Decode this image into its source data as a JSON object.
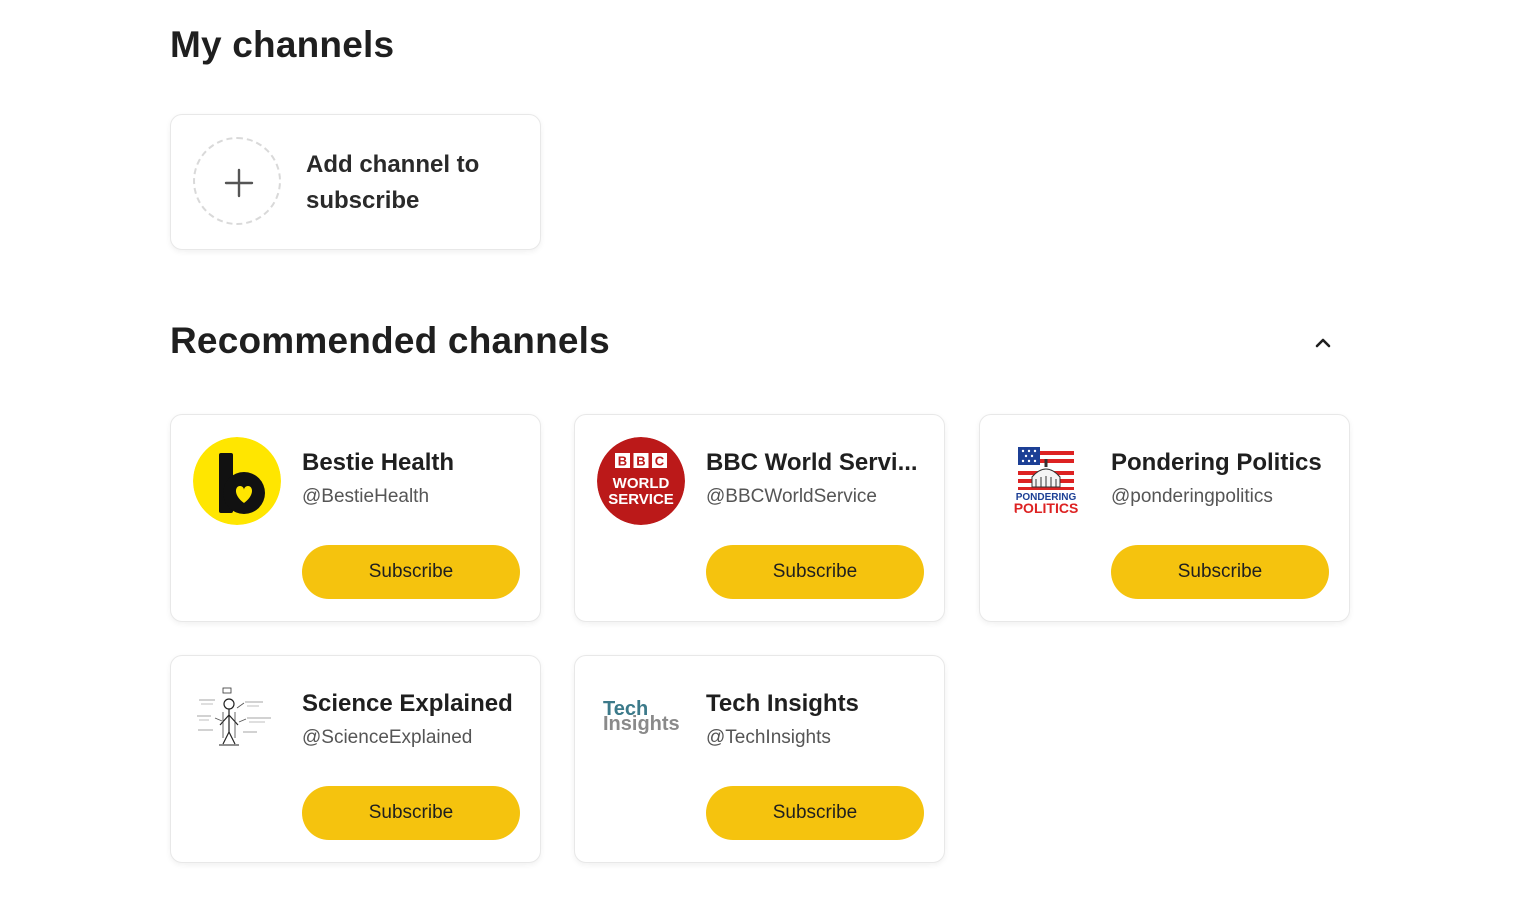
{
  "my_channels": {
    "title": "My channels",
    "add_card": {
      "label": "Add channel to subscribe",
      "icon": "plus-icon"
    }
  },
  "recommended": {
    "title": "Recommended channels",
    "collapse_icon": "chevron-up-icon",
    "subscribe_label": "Subscribe",
    "accent_color": "#f5c30e",
    "channels": [
      {
        "name": "Bestie Health",
        "handle": "@BestieHealth",
        "avatar": "bestie-health-logo",
        "subscribe": "Subscribe"
      },
      {
        "name": "BBC World Servi...",
        "handle": "@BBCWorldService",
        "avatar": "bbc-world-service-logo",
        "subscribe": "Subscribe",
        "logo_text": {
          "bbc": [
            "B",
            "B",
            "C"
          ],
          "line1": "WORLD",
          "line2": "SERVICE"
        }
      },
      {
        "name": "Pondering Politics",
        "handle": "@ponderingpolitics",
        "avatar": "pondering-politics-logo",
        "subscribe": "Subscribe",
        "logo_text": {
          "line1": "PONDERING",
          "line2": "POLITICS"
        }
      },
      {
        "name": "Science Explained",
        "handle": "@ScienceExplained",
        "avatar": "science-explained-sketch",
        "subscribe": "Subscribe"
      },
      {
        "name": "Tech Insights",
        "handle": "@TechInsights",
        "avatar": "tech-insights-logo",
        "subscribe": "Subscribe",
        "logo_text": {
          "line1": "Tech",
          "line2": "Insights"
        }
      }
    ]
  }
}
